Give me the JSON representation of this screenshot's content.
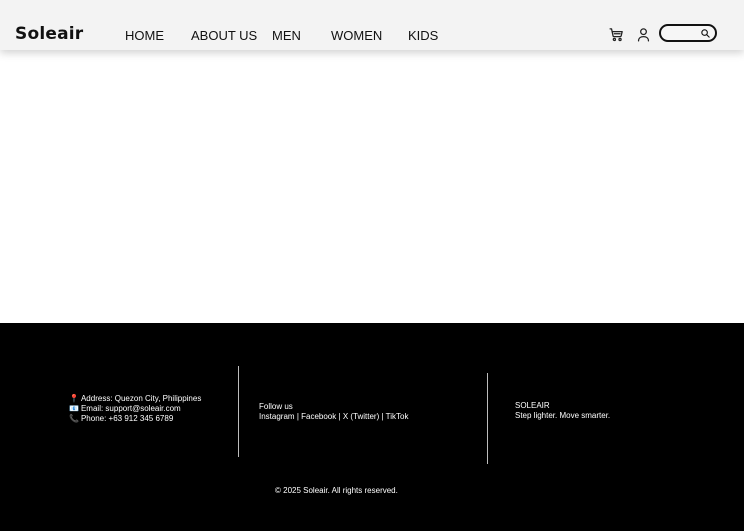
{
  "header": {
    "brand": "Soleair",
    "nav": {
      "home": "HOME",
      "about": "ABOUT US",
      "men": "MEN",
      "women": "WOMEN",
      "kids": "KIDS"
    },
    "icons": {
      "cart": "cart-icon",
      "user": "user-icon",
      "search": "search-icon"
    },
    "search": {
      "value": "",
      "placeholder": ""
    }
  },
  "footer": {
    "contact": {
      "address_icon": "📍",
      "address": "Address: Quezon City, Philippines",
      "email_icon": "📧",
      "email": "Email: support@soleair.com",
      "phone_icon": "📞",
      "phone": "Phone: +63 912 345 6789"
    },
    "social": {
      "title": "Follow us",
      "links": [
        "Instagram",
        "Facebook",
        "X (Twitter)",
        "TikTok"
      ],
      "separator": "|"
    },
    "brand_block": {
      "name": "SOLEAIR",
      "tagline": "Step lighter. Move smarter."
    },
    "copyright": "© 2025 Soleair. All rights reserved."
  },
  "colors": {
    "header_bg": "#f3f3f3",
    "footer_bg": "#000000",
    "text_dark": "#111111",
    "text_light": "#ffffff"
  }
}
